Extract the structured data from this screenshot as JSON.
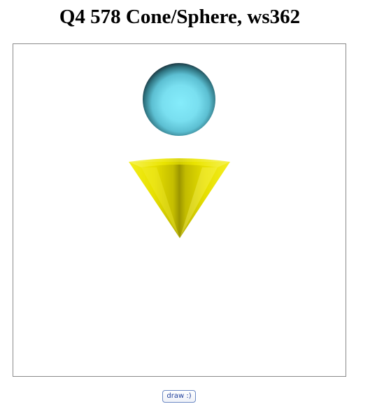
{
  "page": {
    "title": "Q4 578 Cone/Sphere, ws362"
  },
  "scene": {
    "objects": [
      {
        "type": "sphere",
        "color": "#7fe6f7",
        "shadow_color": "#1d3a44"
      },
      {
        "type": "cone",
        "color": "#f0ea00",
        "shadow_color": "#8a8600"
      }
    ]
  },
  "controls": {
    "draw_label": "draw :)"
  }
}
